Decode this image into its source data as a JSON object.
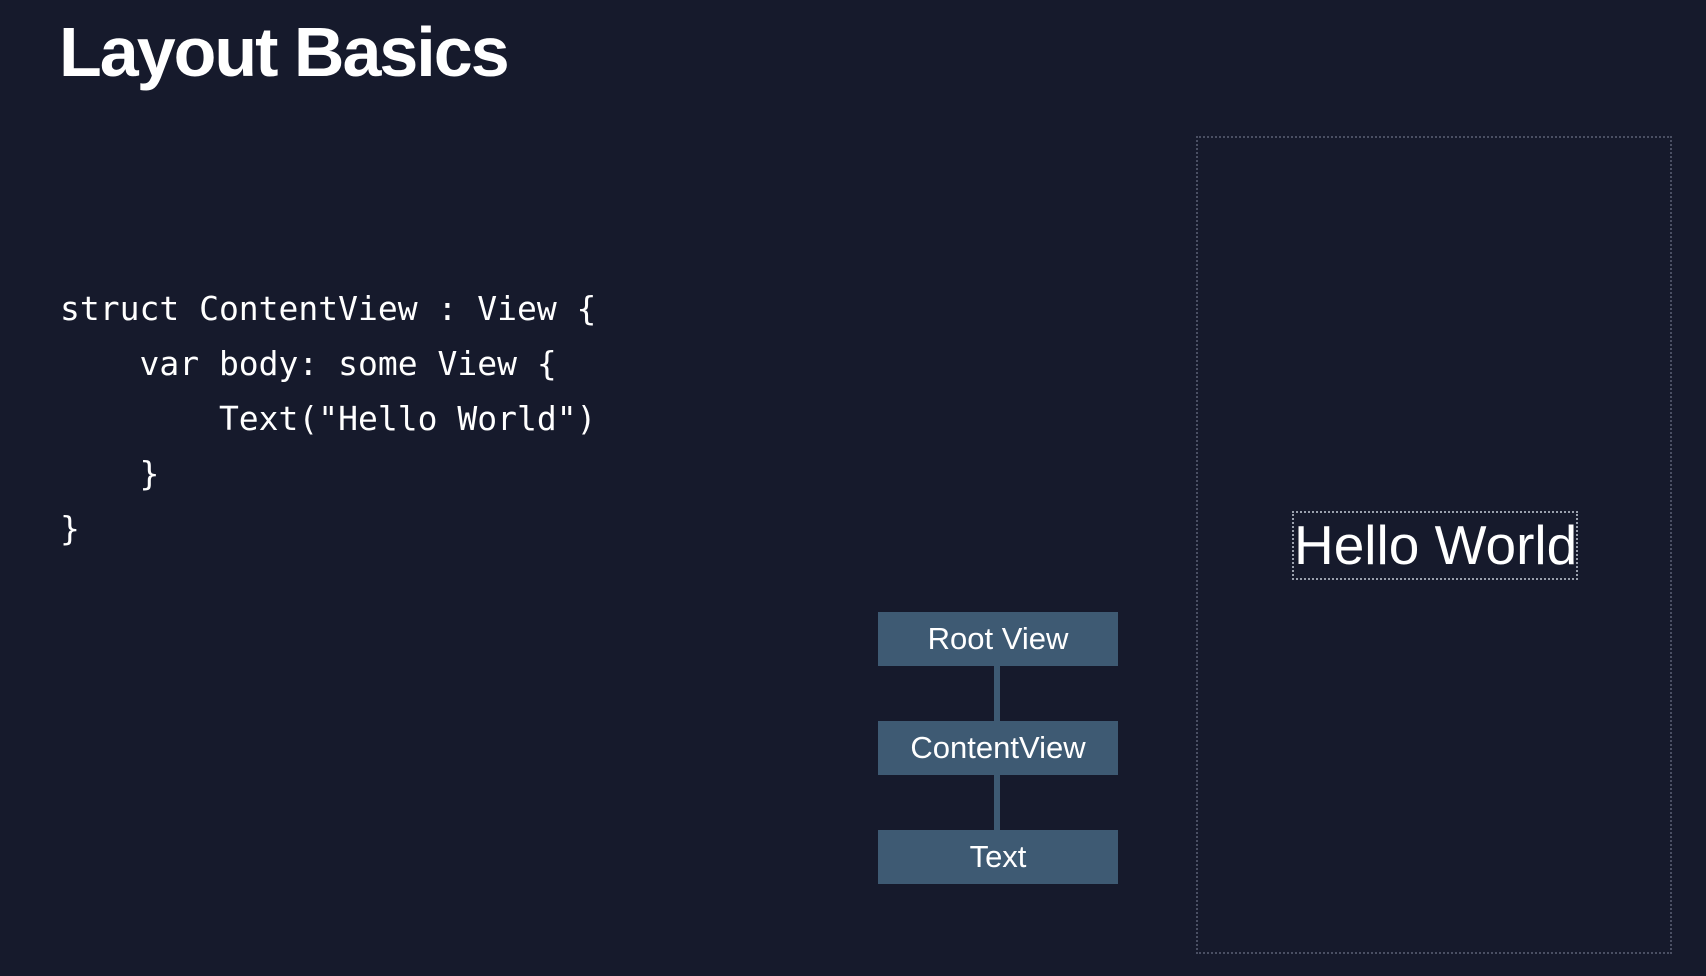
{
  "slide": {
    "title": "Layout Basics"
  },
  "code": {
    "lines": [
      "struct ContentView : View {",
      "    var body: some View {",
      "        Text(\"Hello World\")",
      "    }",
      "}"
    ]
  },
  "view_tree": {
    "nodes": [
      "Root View",
      "ContentView",
      "Text"
    ]
  },
  "preview": {
    "text": "Hello World"
  },
  "colors": {
    "background": "#161a2c",
    "node_fill": "#3e5a73",
    "text": "#ffffff"
  }
}
